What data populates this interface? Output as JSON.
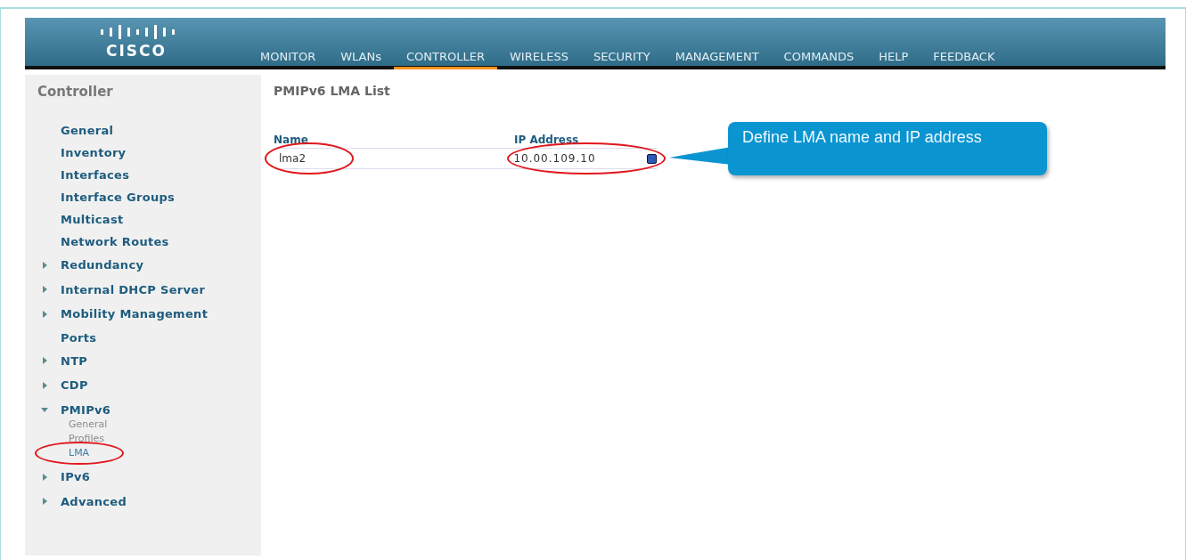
{
  "header": {
    "logo": "CISCO",
    "menu": [
      {
        "label": "MONITOR",
        "selected": false
      },
      {
        "label": "WLANs",
        "selected": false
      },
      {
        "label": "CONTROLLER",
        "selected": true
      },
      {
        "label": "WIRELESS",
        "selected": false
      },
      {
        "label": "SECURITY",
        "selected": false
      },
      {
        "label": "MANAGEMENT",
        "selected": false
      },
      {
        "label": "COMMANDS",
        "selected": false
      },
      {
        "label": "HELP",
        "selected": false
      },
      {
        "label": "FEEDBACK",
        "selected": false
      }
    ]
  },
  "sidebar": {
    "title": "Controller",
    "items": [
      {
        "label": "General",
        "kind": "link"
      },
      {
        "label": "Inventory",
        "kind": "link"
      },
      {
        "label": "Interfaces",
        "kind": "link"
      },
      {
        "label": "Interface Groups",
        "kind": "link"
      },
      {
        "label": "Multicast",
        "kind": "link"
      },
      {
        "label": "Network Routes",
        "kind": "link"
      },
      {
        "label": "Redundancy",
        "kind": "group",
        "expanded": false
      },
      {
        "label": "Internal DHCP Server",
        "kind": "group",
        "expanded": false
      },
      {
        "label": "Mobility Management",
        "kind": "group",
        "expanded": false
      },
      {
        "label": "Ports",
        "kind": "link"
      },
      {
        "label": "NTP",
        "kind": "group",
        "expanded": false
      },
      {
        "label": "CDP",
        "kind": "group",
        "expanded": false
      },
      {
        "label": "PMIPv6",
        "kind": "group",
        "expanded": true,
        "children": [
          {
            "label": "General",
            "selected": false,
            "circled": false
          },
          {
            "label": "Profiles",
            "selected": false,
            "circled": false
          },
          {
            "label": "LMA",
            "selected": true,
            "circled": true
          }
        ]
      },
      {
        "label": "IPv6",
        "kind": "group",
        "expanded": false
      },
      {
        "label": "Advanced",
        "kind": "group",
        "expanded": false
      }
    ]
  },
  "content": {
    "title": "PMIPv6 LMA List",
    "columns": [
      "Name",
      "IP Address"
    ],
    "row": {
      "name": "lma2",
      "ip": "10.00.109.10",
      "circled": true
    },
    "callout": "Define LMA name and IP address"
  }
}
